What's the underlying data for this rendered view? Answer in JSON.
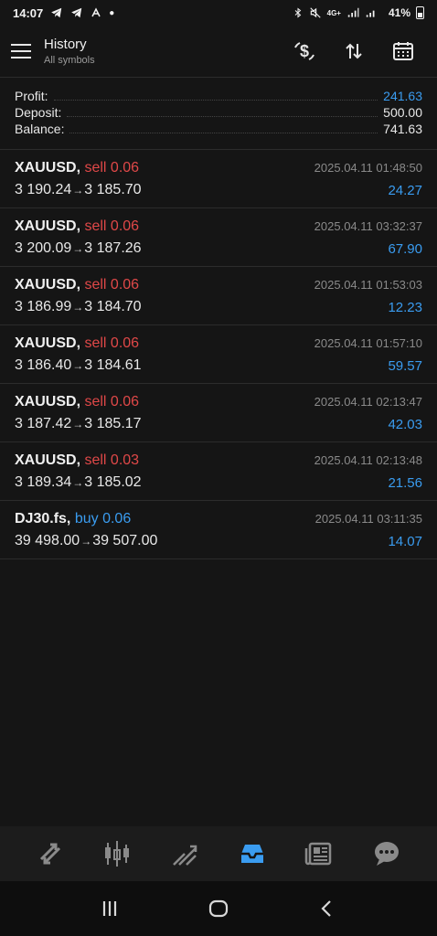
{
  "status": {
    "time": "14:07",
    "battery": "41%",
    "network": "4G+"
  },
  "header": {
    "title": "History",
    "subtitle": "All symbols"
  },
  "summary": [
    {
      "label": "Profit:",
      "value": "241.63",
      "color": "#3a9cf0"
    },
    {
      "label": "Deposit:",
      "value": "500.00",
      "color": "#e8e8e8"
    },
    {
      "label": "Balance:",
      "value": "741.63",
      "color": "#e8e8e8"
    }
  ],
  "deals": [
    {
      "symbol": "XAUUSD,",
      "side": "sell 0.06",
      "side_type": "sell",
      "open": "3 190.24",
      "close": "3 185.70",
      "time": "2025.04.11 01:48:50",
      "profit": "24.27"
    },
    {
      "symbol": "XAUUSD,",
      "side": "sell 0.06",
      "side_type": "sell",
      "open": "3 200.09",
      "close": "3 187.26",
      "time": "2025.04.11 03:32:37",
      "profit": "67.90"
    },
    {
      "symbol": "XAUUSD,",
      "side": "sell 0.06",
      "side_type": "sell",
      "open": "3 186.99",
      "close": "3 184.70",
      "time": "2025.04.11 01:53:03",
      "profit": "12.23"
    },
    {
      "symbol": "XAUUSD,",
      "side": "sell 0.06",
      "side_type": "sell",
      "open": "3 186.40",
      "close": "3 184.61",
      "time": "2025.04.11 01:57:10",
      "profit": "59.57"
    },
    {
      "symbol": "XAUUSD,",
      "side": "sell 0.06",
      "side_type": "sell",
      "open": "3 187.42",
      "close": "3 185.17",
      "time": "2025.04.11 02:13:47",
      "profit": "42.03"
    },
    {
      "symbol": "XAUUSD,",
      "side": "sell 0.03",
      "side_type": "sell",
      "open": "3 189.34",
      "close": "3 185.02",
      "time": "2025.04.11 02:13:48",
      "profit": "21.56"
    },
    {
      "symbol": "DJ30.fs,",
      "side": "buy 0.06",
      "side_type": "buy",
      "open": "39 498.00",
      "close": "39 507.00",
      "time": "2025.04.11 03:11:35",
      "profit": "14.07"
    }
  ],
  "bottom_nav": {
    "items": [
      {
        "icon": "quotes-icon",
        "active": false
      },
      {
        "icon": "chart-icon",
        "active": false
      },
      {
        "icon": "trade-icon",
        "active": false
      },
      {
        "icon": "history-icon",
        "active": true
      },
      {
        "icon": "news-icon",
        "active": false
      },
      {
        "icon": "messages-icon",
        "active": false
      }
    ],
    "active_color": "#3a9cf0",
    "inactive_color": "#8a8a8a"
  }
}
